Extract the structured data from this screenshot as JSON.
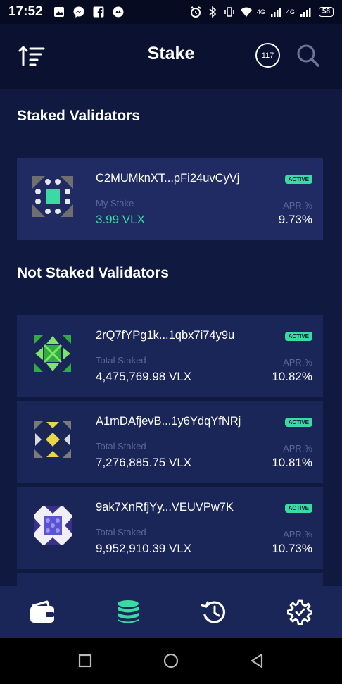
{
  "status_bar": {
    "time": "17:52",
    "left_icons": [
      "gallery-icon",
      "messenger-icon",
      "facebook-icon",
      "app-icon"
    ],
    "network_1": "4G",
    "network_2": "4G",
    "battery": "58"
  },
  "header": {
    "title": "Stake",
    "badge_count": "117",
    "icons": [
      "sort-icon",
      "search-icon"
    ]
  },
  "staked_section": {
    "title": "Staked Validators",
    "validators": [
      {
        "address": "C2MUMknXT...pFi24uvCyVj",
        "status": "ACTIVE",
        "amount_label": "My Stake",
        "amount": "3.99 VLX",
        "apr_label": "APR,%",
        "apr": "9.73%"
      }
    ]
  },
  "not_staked_section": {
    "title": "Not Staked Validators",
    "validators": [
      {
        "address": "2rQ7fYPg1k...1qbx7i74y9u",
        "status": "ACTIVE",
        "amount_label": "Total Staked",
        "amount": "4,475,769.98 VLX",
        "apr_label": "APR,%",
        "apr": "10.82%"
      },
      {
        "address": "A1mDAfjevB...1y6YdqYfNRj",
        "status": "ACTIVE",
        "amount_label": "Total Staked",
        "amount": "7,276,885.75 VLX",
        "apr_label": "APR,%",
        "apr": "10.81%"
      },
      {
        "address": "9ak7XnRfjYy...VEUVPw7K",
        "status": "ACTIVE",
        "amount_label": "Total Staked",
        "amount": "9,952,910.39 VLX",
        "apr_label": "APR,%",
        "apr": "10.73%"
      }
    ]
  },
  "bottom_nav": {
    "items": [
      "wallet-icon",
      "stake-icon",
      "history-icon",
      "settings-icon"
    ],
    "active": "stake-icon"
  },
  "colors": {
    "accent": "#3bd9a4",
    "background": "#101940",
    "card": "#1b2658"
  }
}
